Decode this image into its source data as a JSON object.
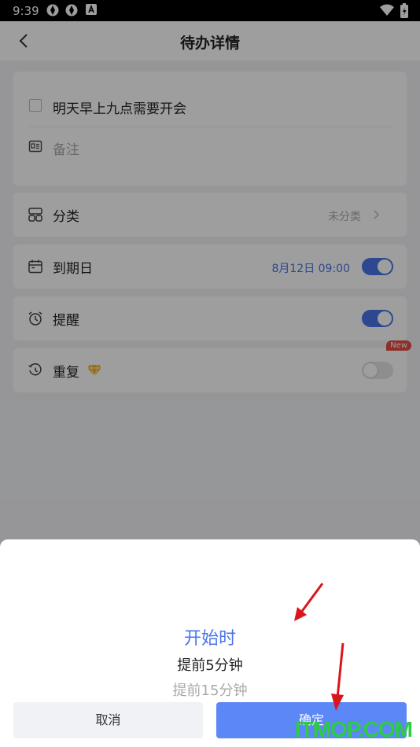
{
  "status_bar": {
    "time": "9:39"
  },
  "header": {
    "title": "待办详情"
  },
  "task": {
    "title": "明天早上九点需要开会",
    "note_placeholder": "备注"
  },
  "rows": {
    "category": {
      "label": "分类",
      "value": "未分类"
    },
    "due": {
      "label": "到期日",
      "value": "8月12日 09:00",
      "enabled": true
    },
    "reminder": {
      "label": "提醒",
      "enabled": true
    },
    "repeat": {
      "label": "重复",
      "badge": "New",
      "enabled": false
    }
  },
  "sheet": {
    "options": [
      "开始时",
      "提前5分钟",
      "提前15分钟"
    ],
    "selected": "开始时",
    "cancel_label": "取消",
    "confirm_label": "确定"
  },
  "watermark": "ITMOP.COM",
  "colors": {
    "accent": "#4a74e9",
    "toggle_on": "#4a74e9",
    "badge": "#e54d42",
    "arrow": "#d9161b"
  }
}
